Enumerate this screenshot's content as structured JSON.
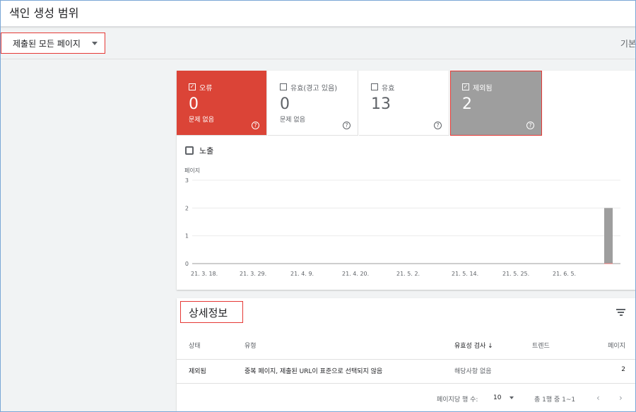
{
  "header": {
    "title": "색인 생성 범위"
  },
  "filterbar": {
    "selected": "제출된 모든 페이지",
    "right_text": "기본"
  },
  "tiles": [
    {
      "label": "오류",
      "value": "0",
      "sub": "문제 없음",
      "checked": true,
      "color": "#db4437"
    },
    {
      "label": "유효(경고 있음)",
      "value": "0",
      "sub": "문제 없음",
      "checked": false
    },
    {
      "label": "유효",
      "value": "13",
      "sub": "",
      "checked": false
    },
    {
      "label": "제외됨",
      "value": "2",
      "sub": "",
      "checked": true,
      "color": "#9e9e9e"
    }
  ],
  "impressions": {
    "label": "노출",
    "checked": false
  },
  "chart_data": {
    "type": "bar",
    "ylabel": "페이지",
    "ylim": [
      0,
      3
    ],
    "yticks": [
      "0",
      "1",
      "2",
      "3"
    ],
    "xticks": [
      "21. 3. 18.",
      "21. 3. 29.",
      "21. 4. 9.",
      "21. 4. 20.",
      "21. 5. 2.",
      "21. 5. 14.",
      "21. 5. 25.",
      "21. 6. 5."
    ],
    "grid": true,
    "series": [
      {
        "values": [
          2,
          2
        ],
        "color": "#9e9e9e"
      }
    ]
  },
  "details": {
    "title": "상세정보",
    "columns": [
      "상태",
      "유형",
      "유효성 검사",
      "트렌드",
      "페이지"
    ],
    "rows": [
      {
        "status": "제외됨",
        "type": "중복 페이지, 제출된 URL이 표준으로 선택되지 않음",
        "validation": "해당사항 없음",
        "pages": "2"
      }
    ],
    "pager": {
      "rows_per_page_label": "페이지당 행 수:",
      "rows_per_page": "10",
      "range": "총 1행 중 1~1"
    }
  }
}
